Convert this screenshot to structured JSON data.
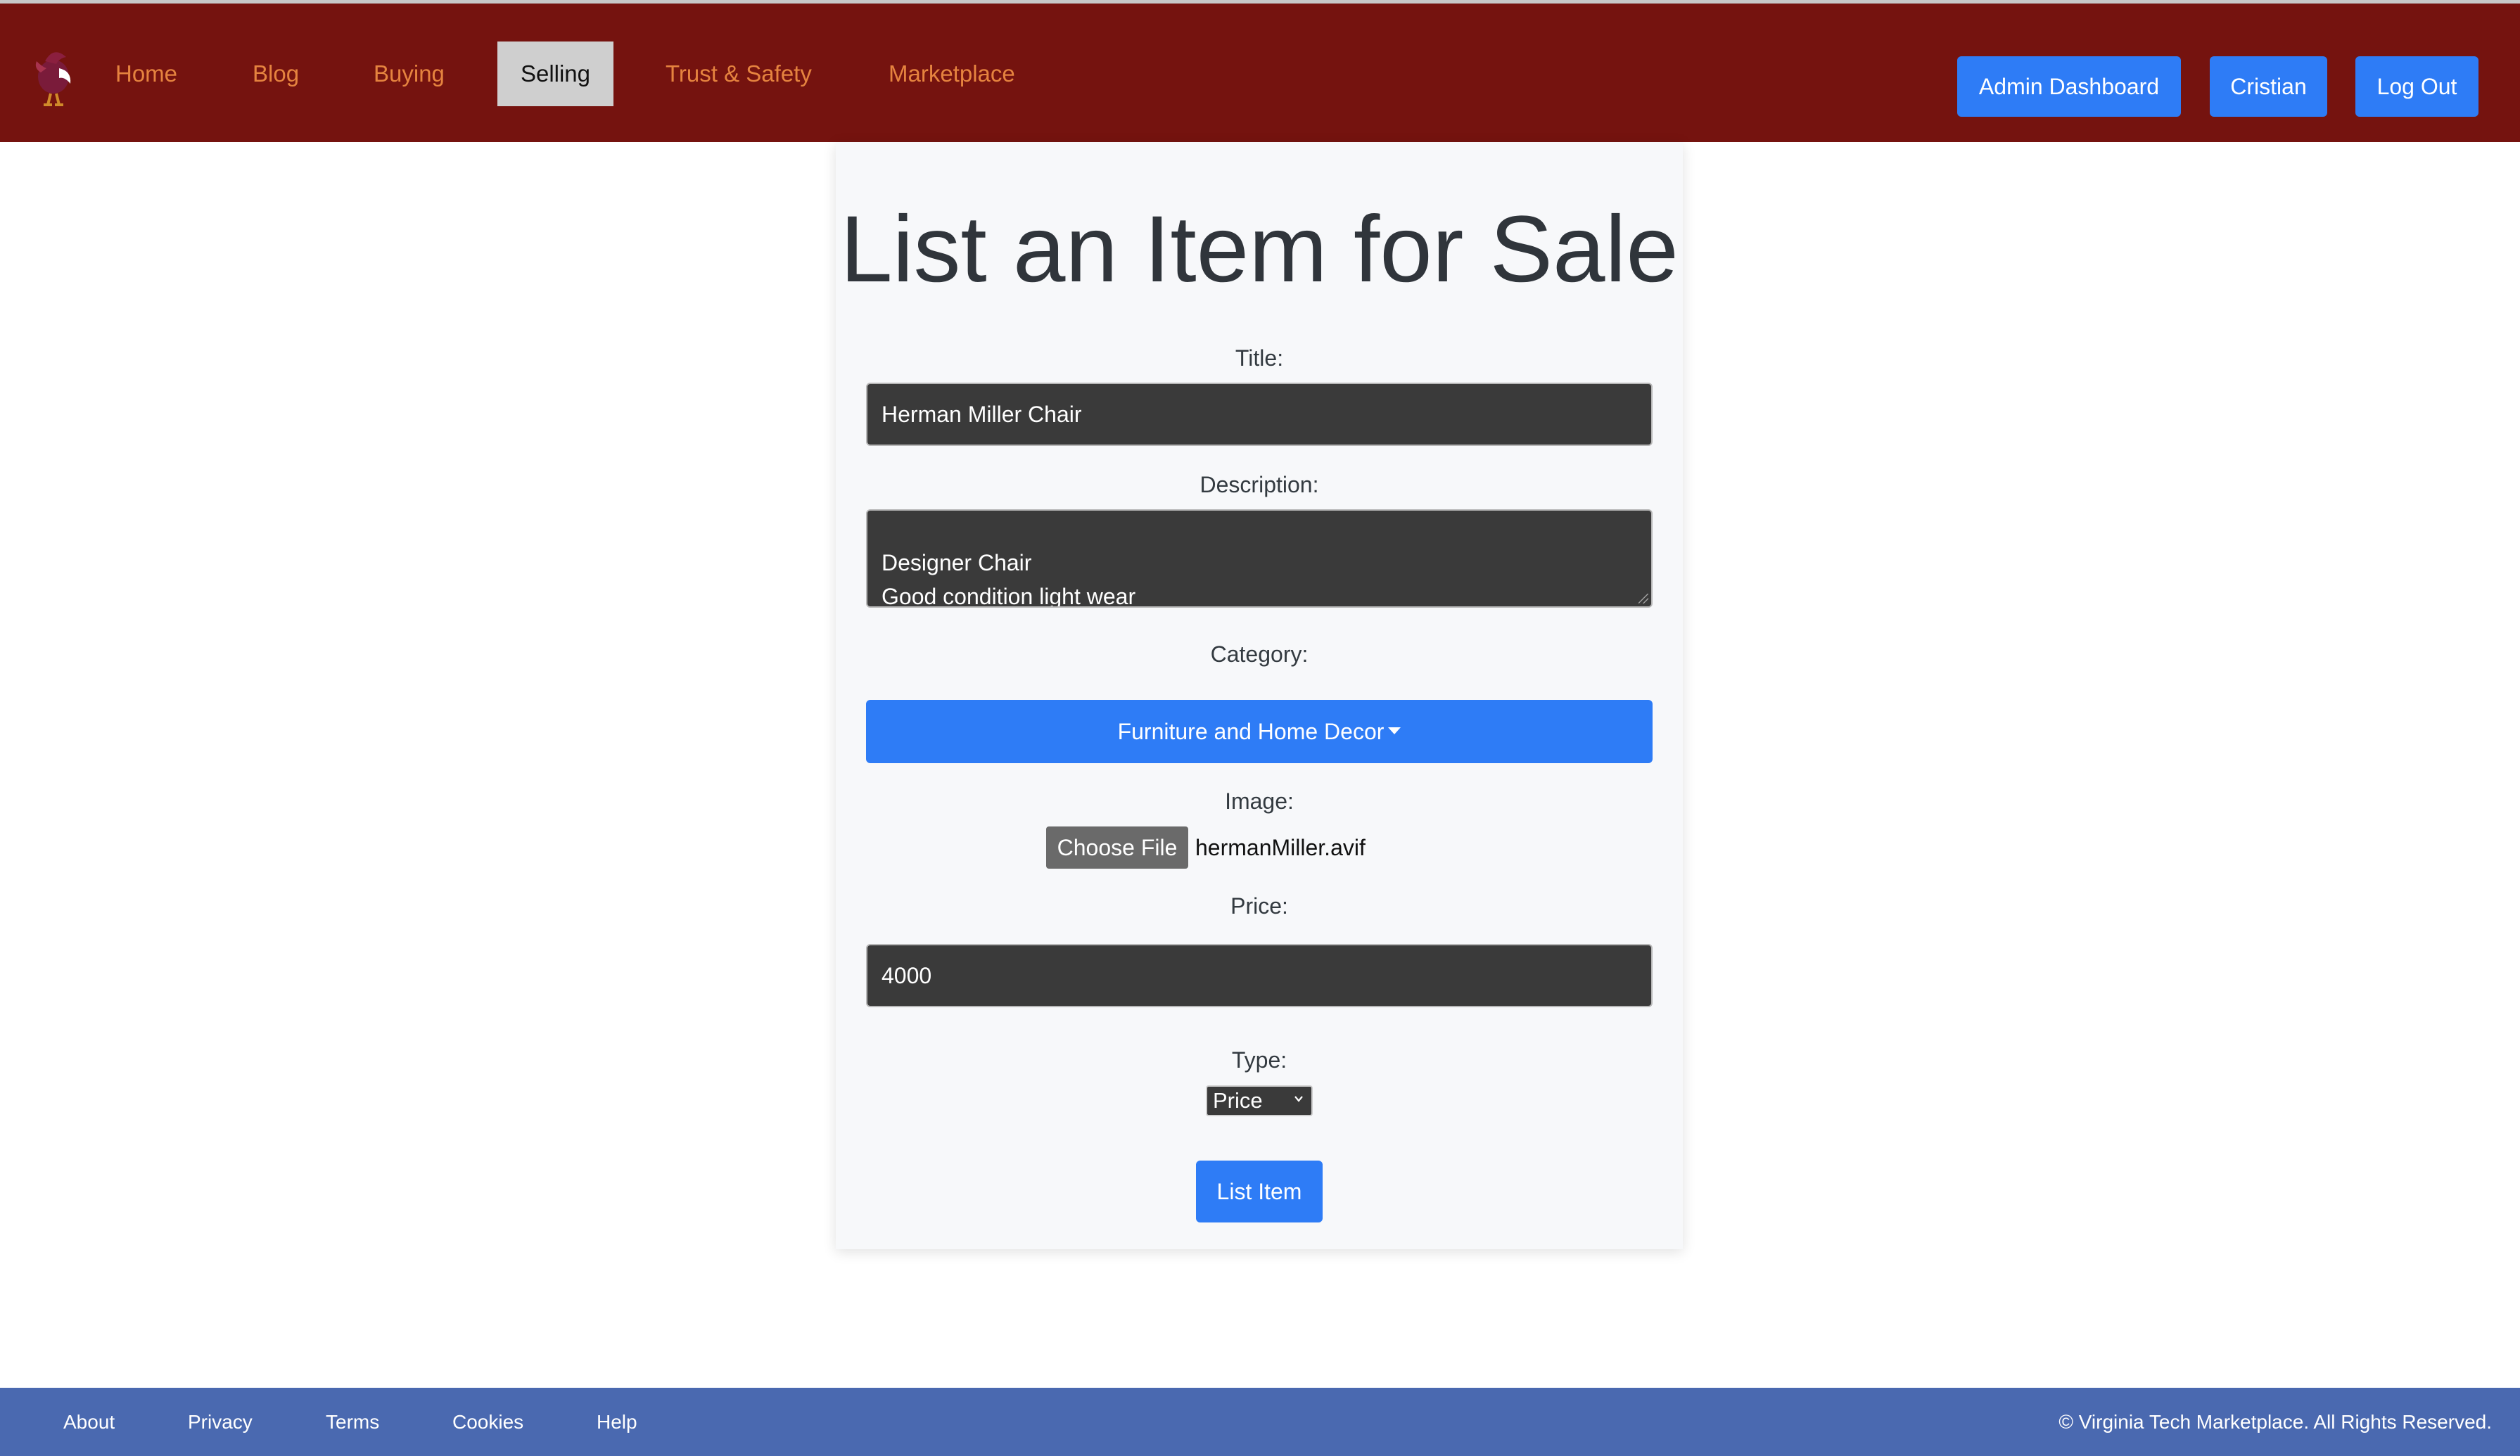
{
  "nav": {
    "links": [
      {
        "label": "Home"
      },
      {
        "label": "Blog"
      },
      {
        "label": "Buying"
      },
      {
        "label": "Selling"
      },
      {
        "label": "Trust & Safety"
      },
      {
        "label": "Marketplace"
      }
    ],
    "active": "Selling",
    "admin_label": "Admin Dashboard",
    "user_label": "Cristian",
    "logout_label": "Log Out"
  },
  "form": {
    "heading": "List an Item for Sale",
    "title_label": "Title:",
    "title_value": "Herman Miller Chair",
    "description_label": "Description:",
    "description_value": "Designer Chair\nGood condition light wear",
    "category_label": "Category:",
    "category_value": "Furniture and Home Decor",
    "image_label": "Image:",
    "choose_file_label": "Choose File",
    "file_name": "hermanMiller.avif",
    "price_label": "Price:",
    "price_value": "4000",
    "type_label": "Type:",
    "type_value": "Price",
    "submit_label": "List Item"
  },
  "footer": {
    "links": [
      {
        "label": "About"
      },
      {
        "label": "Privacy"
      },
      {
        "label": "Terms"
      },
      {
        "label": "Cookies"
      },
      {
        "label": "Help"
      }
    ],
    "copyright": "© Virginia Tech Marketplace. All Rights Reserved."
  },
  "colors": {
    "nav_background": "#75130f",
    "nav_link": "#e5833f",
    "primary_button": "#2e7cf6",
    "footer_background": "#4a69b0",
    "field_background": "#3a3a3a"
  },
  "icons": {
    "logo": "hokie-bird-logo-icon",
    "dropdown": "caret-down-icon",
    "select": "chevron-down-icon"
  }
}
